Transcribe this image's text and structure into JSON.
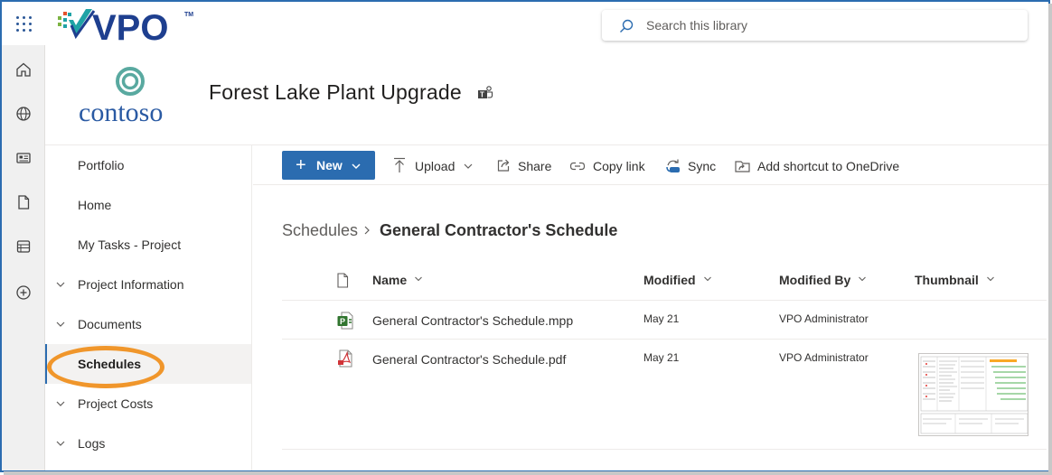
{
  "brand": {
    "product": "VPO",
    "trademark": "TM",
    "colors": {
      "primary": "#1e3f8f",
      "teal": "#1fa3a6",
      "green": "#7cb342"
    }
  },
  "search": {
    "placeholder": "Search this library"
  },
  "rail": {
    "items": [
      {
        "icon": "waffle-icon"
      },
      {
        "icon": "home-icon"
      },
      {
        "icon": "globe-icon"
      },
      {
        "icon": "news-icon"
      },
      {
        "icon": "document-icon"
      },
      {
        "icon": "list-icon"
      },
      {
        "icon": "add-circle-icon"
      }
    ]
  },
  "site": {
    "logo_text": "contoso",
    "title": "Forest Lake Plant Upgrade",
    "teams_icon": "teams-icon"
  },
  "nav": {
    "items": [
      {
        "label": "Portfolio",
        "expandable": false
      },
      {
        "label": "Home",
        "expandable": false
      },
      {
        "label": "My Tasks - Project",
        "expandable": false
      },
      {
        "label": "Project Information",
        "expandable": true
      },
      {
        "label": "Documents",
        "expandable": true
      },
      {
        "label": "Schedules",
        "expandable": false,
        "selected": true
      },
      {
        "label": "Project Costs",
        "expandable": true
      },
      {
        "label": "Logs",
        "expandable": true
      }
    ]
  },
  "commands": {
    "new_label": "New",
    "upload_label": "Upload",
    "share_label": "Share",
    "copy_link_label": "Copy link",
    "sync_label": "Sync",
    "shortcut_label": "Add shortcut to OneDrive"
  },
  "breadcrumb": {
    "root": "Schedules",
    "current": "General Contractor's Schedule"
  },
  "list": {
    "columns": {
      "name": "Name",
      "modified": "Modified",
      "modified_by": "Modified By",
      "thumbnail": "Thumbnail"
    },
    "rows": [
      {
        "name": "General Contractor's Schedule.mpp",
        "modified": "May 21",
        "modified_by": "VPO Administrator",
        "type": "project-file-icon"
      },
      {
        "name": "General Contractor's Schedule.pdf",
        "modified": "May 21",
        "modified_by": "VPO Administrator",
        "type": "pdf-file-icon"
      }
    ]
  },
  "accent": {
    "theme_blue": "#2b6cb0",
    "highlight_orange": "#f0962b"
  }
}
